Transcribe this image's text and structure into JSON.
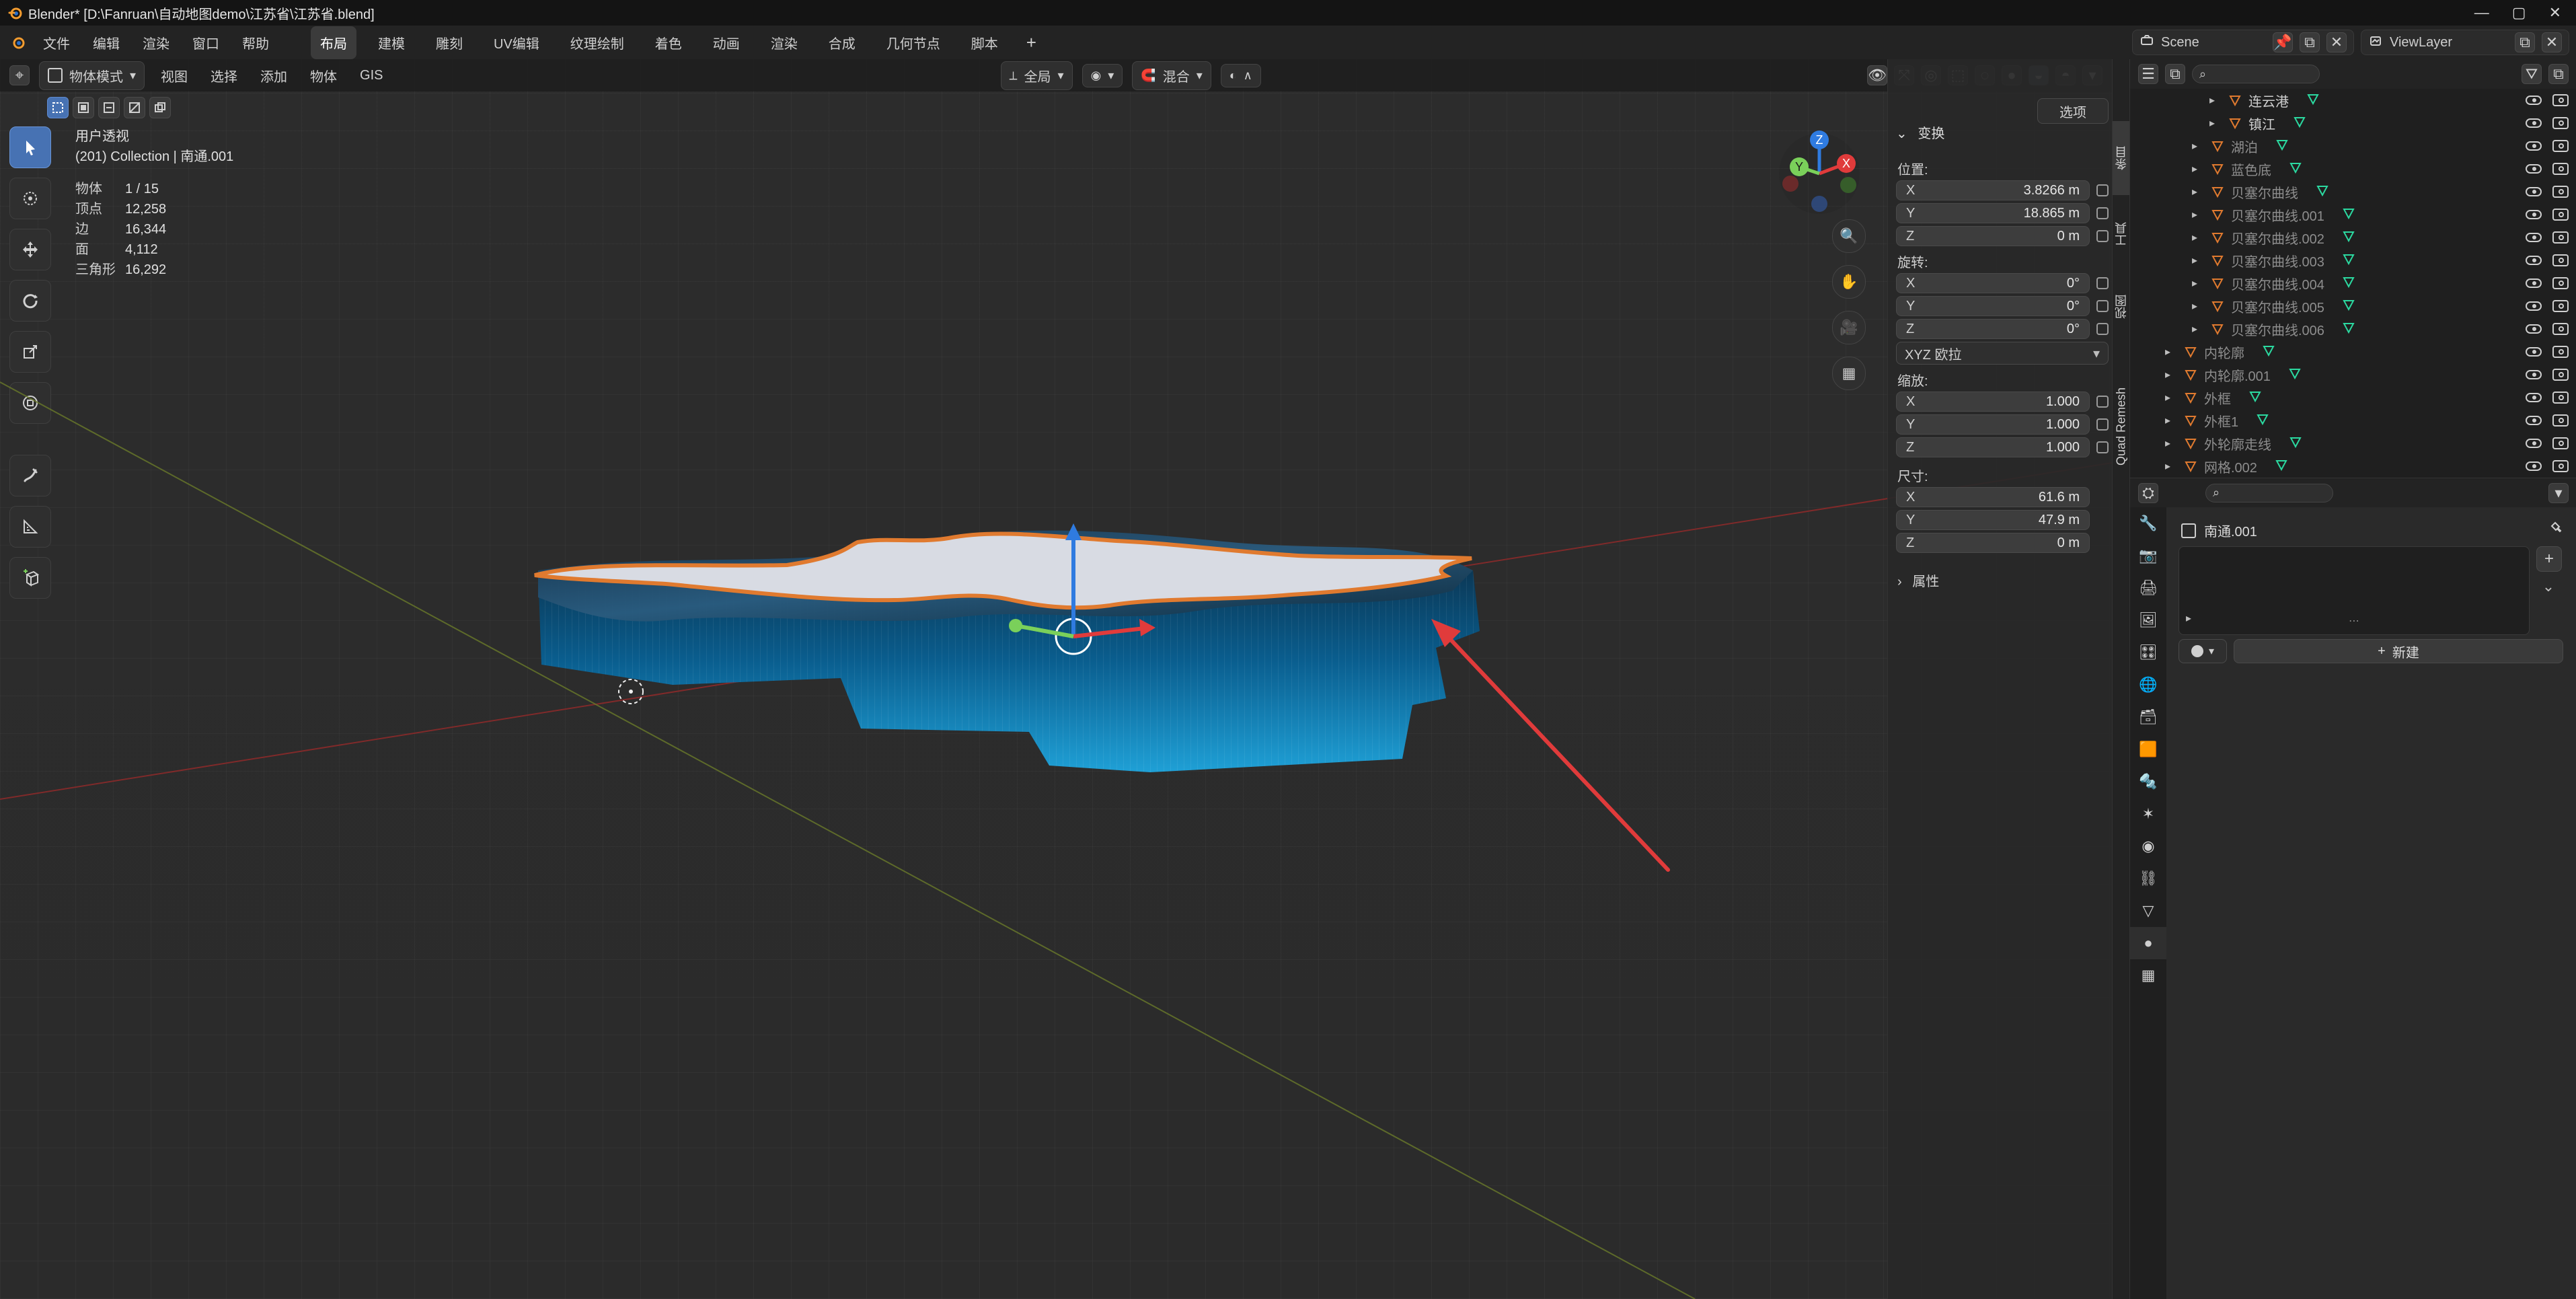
{
  "window": {
    "title": "Blender* [D:\\Fanruan\\自动地图demo\\江苏省\\江苏省.blend]"
  },
  "menubar": {
    "menus": [
      "文件",
      "编辑",
      "渲染",
      "窗口",
      "帮助"
    ],
    "workspaces": [
      "布局",
      "建模",
      "雕刻",
      "UV编辑",
      "纹理绘制",
      "着色",
      "动画",
      "渲染",
      "合成",
      "几何节点",
      "脚本"
    ],
    "active_workspace": "布局",
    "scene_label": "Scene",
    "viewlayer_label": "ViewLayer"
  },
  "viewport": {
    "header": {
      "mode": "物体模式",
      "menus": [
        "视图",
        "选择",
        "添加",
        "物体",
        "GIS"
      ],
      "transform_orientation": "全局",
      "pivot": "混合",
      "options": "选项"
    },
    "overlay": {
      "view_name": "用户透视",
      "collection_line": "(201) Collection | 南通.001",
      "stats": [
        {
          "k": "物体",
          "v": "1 / 15"
        },
        {
          "k": "顶点",
          "v": "12,258"
        },
        {
          "k": "边",
          "v": "16,344"
        },
        {
          "k": "面",
          "v": "4,112"
        },
        {
          "k": "三角形",
          "v": "16,292"
        }
      ]
    }
  },
  "npanel": {
    "section_title": "变换",
    "location_label": "位置:",
    "rotation_label": "旋转:",
    "scale_label": "缩放:",
    "dimensions_label": "尺寸:",
    "location": {
      "x": "3.8266 m",
      "y": "18.865 m",
      "z": "0 m"
    },
    "rotation": {
      "x": "0°",
      "y": "0°",
      "z": "0°"
    },
    "rotation_mode": "XYZ 欧拉",
    "scale": {
      "x": "1.000",
      "y": "1.000",
      "z": "1.000"
    },
    "dimensions": {
      "x": "61.6 m",
      "y": "47.9 m",
      "z": "0 m"
    },
    "properties_collapsed": "属性",
    "tabs": [
      "条目",
      "工具",
      "视图",
      "Quad Remesh"
    ],
    "active_tab": "条目"
  },
  "outliner": {
    "items": [
      {
        "label": "连云港",
        "level": "child",
        "dim": false
      },
      {
        "label": "镇江",
        "level": "child",
        "dim": false
      },
      {
        "label": "湖泊",
        "level": "top",
        "dim": true
      },
      {
        "label": "蓝色底",
        "level": "top",
        "dim": true
      },
      {
        "label": "贝塞尔曲线",
        "level": "top",
        "dim": true
      },
      {
        "label": "贝塞尔曲线.001",
        "level": "top",
        "dim": true
      },
      {
        "label": "贝塞尔曲线.002",
        "level": "top",
        "dim": true
      },
      {
        "label": "贝塞尔曲线.003",
        "level": "top",
        "dim": true
      },
      {
        "label": "贝塞尔曲线.004",
        "level": "top",
        "dim": true
      },
      {
        "label": "贝塞尔曲线.005",
        "level": "top",
        "dim": true
      },
      {
        "label": "贝塞尔曲线.006",
        "level": "top",
        "dim": true
      },
      {
        "label": "内轮廓",
        "level": "top",
        "dim": true
      },
      {
        "label": "内轮廓.001",
        "level": "top",
        "dim": true
      },
      {
        "label": "外框",
        "level": "top",
        "dim": true
      },
      {
        "label": "外框1",
        "level": "top",
        "dim": true
      },
      {
        "label": "外轮廓走线",
        "level": "top",
        "dim": true
      },
      {
        "label": "网格.002",
        "level": "top",
        "dim": true
      }
    ]
  },
  "properties": {
    "object_name": "南通.001",
    "new_button": "新建"
  },
  "colors": {
    "accent": "#4772b3",
    "orange": "#e07a2f",
    "teal": "#2bd9a0",
    "red_arrow": "#e03b3b"
  }
}
